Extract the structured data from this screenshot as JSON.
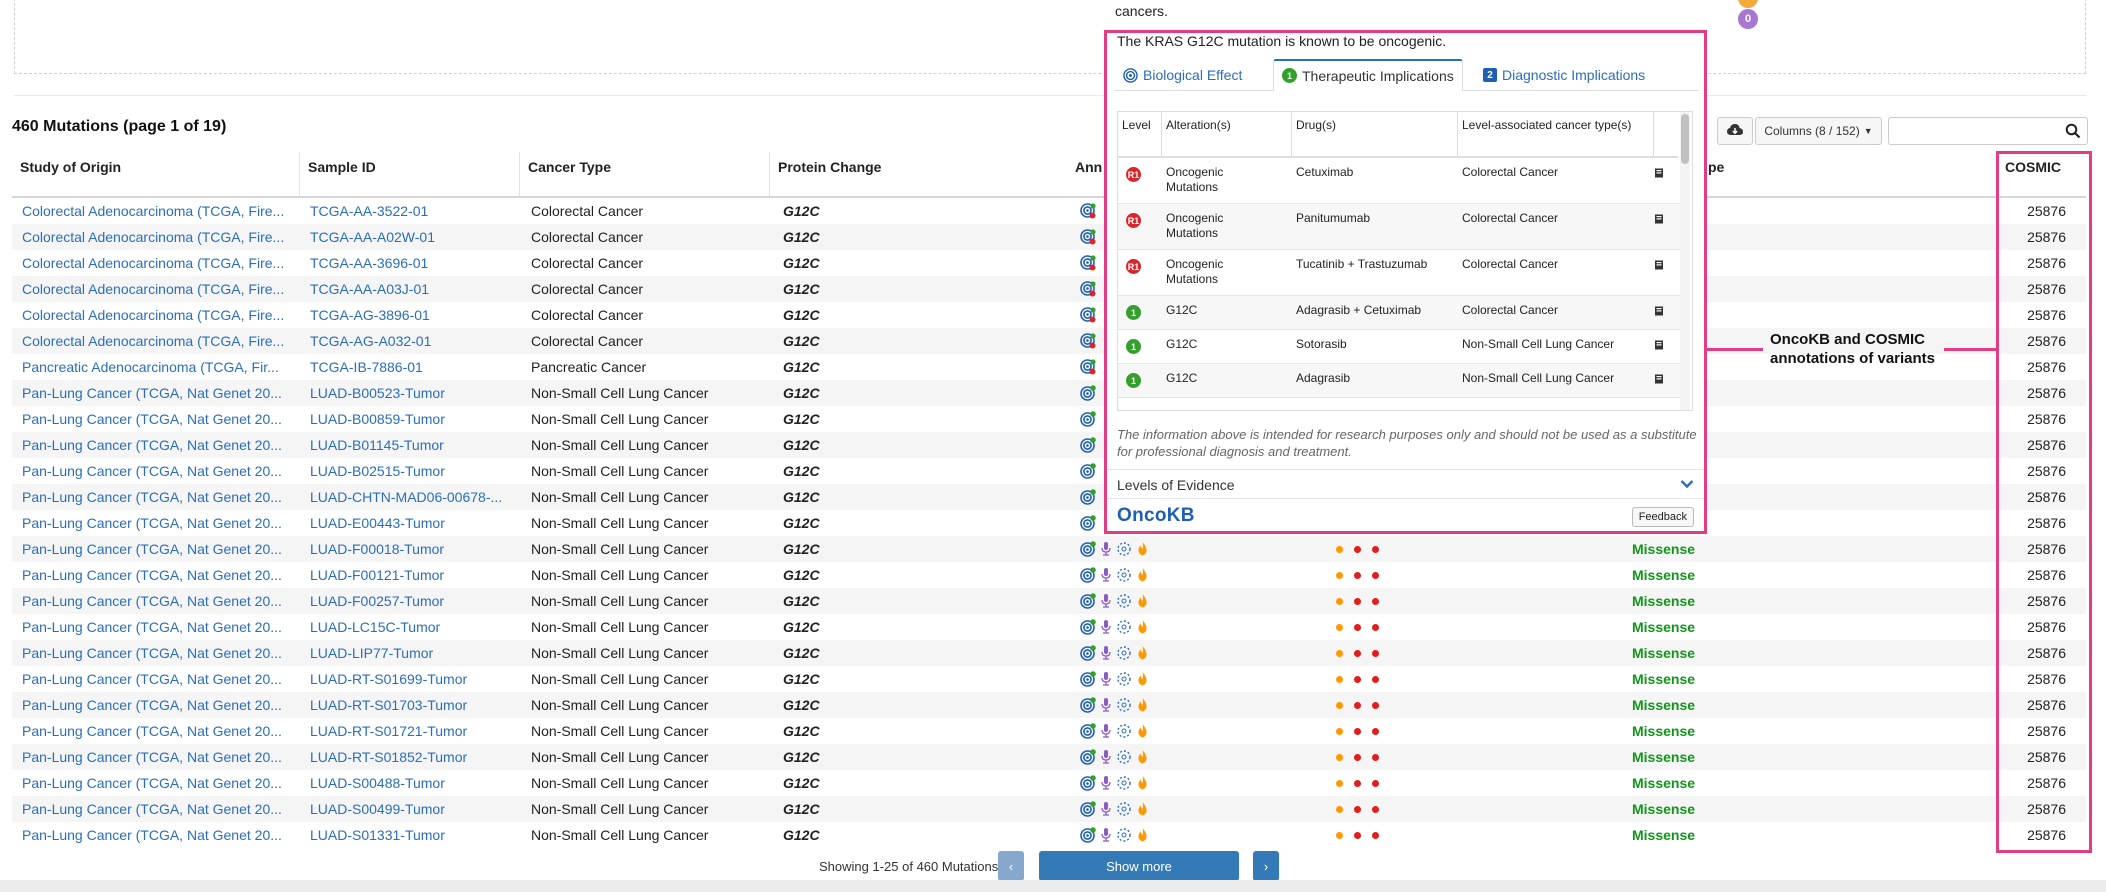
{
  "page": {
    "count_title": "460 Mutations (page 1 of 19)",
    "pager_text": "Showing 1-25 of 460 Mutations",
    "show_more": "Show more",
    "prev": "‹",
    "next": "›"
  },
  "toolbar": {
    "columns_label": "Columns (8 / 152)",
    "search_placeholder": ""
  },
  "table": {
    "headers": {
      "study": "Study of Origin",
      "sample": "Sample ID",
      "cancer": "Cancer Type",
      "protein": "Protein Change",
      "annotation": "Ann",
      "type": "pe",
      "cosmic": "COSMIC"
    },
    "rows": [
      {
        "study": "Colorectal Adenocarcinoma (TCGA, Fire...",
        "sample": "TCGA-AA-3522-01",
        "cancer": "Colorectal Cancer",
        "protein": "G12C",
        "mtype": "",
        "cosmic": "25876"
      },
      {
        "study": "Colorectal Adenocarcinoma (TCGA, Fire...",
        "sample": "TCGA-AA-A02W-01",
        "cancer": "Colorectal Cancer",
        "protein": "G12C",
        "mtype": "",
        "cosmic": "25876"
      },
      {
        "study": "Colorectal Adenocarcinoma (TCGA, Fire...",
        "sample": "TCGA-AA-3696-01",
        "cancer": "Colorectal Cancer",
        "protein": "G12C",
        "mtype": "",
        "cosmic": "25876"
      },
      {
        "study": "Colorectal Adenocarcinoma (TCGA, Fire...",
        "sample": "TCGA-AA-A03J-01",
        "cancer": "Colorectal Cancer",
        "protein": "G12C",
        "mtype": "",
        "cosmic": "25876"
      },
      {
        "study": "Colorectal Adenocarcinoma (TCGA, Fire...",
        "sample": "TCGA-AG-3896-01",
        "cancer": "Colorectal Cancer",
        "protein": "G12C",
        "mtype": "",
        "cosmic": "25876"
      },
      {
        "study": "Colorectal Adenocarcinoma (TCGA, Fire...",
        "sample": "TCGA-AG-A032-01",
        "cancer": "Colorectal Cancer",
        "protein": "G12C",
        "mtype": "",
        "cosmic": "25876"
      },
      {
        "study": "Pancreatic Adenocarcinoma (TCGA, Fir...",
        "sample": "TCGA-IB-7886-01",
        "cancer": "Pancreatic Cancer",
        "protein": "G12C",
        "mtype": "",
        "cosmic": "25876"
      },
      {
        "study": "Pan-Lung Cancer (TCGA, Nat Genet 20...",
        "sample": "LUAD-B00523-Tumor",
        "cancer": "Non-Small Cell Lung Cancer",
        "protein": "G12C",
        "mtype": "",
        "cosmic": "25876"
      },
      {
        "study": "Pan-Lung Cancer (TCGA, Nat Genet 20...",
        "sample": "LUAD-B00859-Tumor",
        "cancer": "Non-Small Cell Lung Cancer",
        "protein": "G12C",
        "mtype": "",
        "cosmic": "25876"
      },
      {
        "study": "Pan-Lung Cancer (TCGA, Nat Genet 20...",
        "sample": "LUAD-B01145-Tumor",
        "cancer": "Non-Small Cell Lung Cancer",
        "protein": "G12C",
        "mtype": "",
        "cosmic": "25876"
      },
      {
        "study": "Pan-Lung Cancer (TCGA, Nat Genet 20...",
        "sample": "LUAD-B02515-Tumor",
        "cancer": "Non-Small Cell Lung Cancer",
        "protein": "G12C",
        "mtype": "",
        "cosmic": "25876"
      },
      {
        "study": "Pan-Lung Cancer (TCGA, Nat Genet 20...",
        "sample": "LUAD-CHTN-MAD06-00678-...",
        "cancer": "Non-Small Cell Lung Cancer",
        "protein": "G12C",
        "mtype": "",
        "cosmic": "25876"
      },
      {
        "study": "Pan-Lung Cancer (TCGA, Nat Genet 20...",
        "sample": "LUAD-E00443-Tumor",
        "cancer": "Non-Small Cell Lung Cancer",
        "protein": "G12C",
        "mtype": "",
        "cosmic": "25876"
      },
      {
        "study": "Pan-Lung Cancer (TCGA, Nat Genet 20...",
        "sample": "LUAD-F00018-Tumor",
        "cancer": "Non-Small Cell Lung Cancer",
        "protein": "G12C",
        "mtype": "Missense",
        "cosmic": "25876"
      },
      {
        "study": "Pan-Lung Cancer (TCGA, Nat Genet 20...",
        "sample": "LUAD-F00121-Tumor",
        "cancer": "Non-Small Cell Lung Cancer",
        "protein": "G12C",
        "mtype": "Missense",
        "cosmic": "25876"
      },
      {
        "study": "Pan-Lung Cancer (TCGA, Nat Genet 20...",
        "sample": "LUAD-F00257-Tumor",
        "cancer": "Non-Small Cell Lung Cancer",
        "protein": "G12C",
        "mtype": "Missense",
        "cosmic": "25876"
      },
      {
        "study": "Pan-Lung Cancer (TCGA, Nat Genet 20...",
        "sample": "LUAD-LC15C-Tumor",
        "cancer": "Non-Small Cell Lung Cancer",
        "protein": "G12C",
        "mtype": "Missense",
        "cosmic": "25876"
      },
      {
        "study": "Pan-Lung Cancer (TCGA, Nat Genet 20...",
        "sample": "LUAD-LIP77-Tumor",
        "cancer": "Non-Small Cell Lung Cancer",
        "protein": "G12C",
        "mtype": "Missense",
        "cosmic": "25876"
      },
      {
        "study": "Pan-Lung Cancer (TCGA, Nat Genet 20...",
        "sample": "LUAD-RT-S01699-Tumor",
        "cancer": "Non-Small Cell Lung Cancer",
        "protein": "G12C",
        "mtype": "Missense",
        "cosmic": "25876"
      },
      {
        "study": "Pan-Lung Cancer (TCGA, Nat Genet 20...",
        "sample": "LUAD-RT-S01703-Tumor",
        "cancer": "Non-Small Cell Lung Cancer",
        "protein": "G12C",
        "mtype": "Missense",
        "cosmic": "25876"
      },
      {
        "study": "Pan-Lung Cancer (TCGA, Nat Genet 20...",
        "sample": "LUAD-RT-S01721-Tumor",
        "cancer": "Non-Small Cell Lung Cancer",
        "protein": "G12C",
        "mtype": "Missense",
        "cosmic": "25876"
      },
      {
        "study": "Pan-Lung Cancer (TCGA, Nat Genet 20...",
        "sample": "LUAD-RT-S01852-Tumor",
        "cancer": "Non-Small Cell Lung Cancer",
        "protein": "G12C",
        "mtype": "Missense",
        "cosmic": "25876"
      },
      {
        "study": "Pan-Lung Cancer (TCGA, Nat Genet 20...",
        "sample": "LUAD-S00488-Tumor",
        "cancer": "Non-Small Cell Lung Cancer",
        "protein": "G12C",
        "mtype": "Missense",
        "cosmic": "25876"
      },
      {
        "study": "Pan-Lung Cancer (TCGA, Nat Genet 20...",
        "sample": "LUAD-S00499-Tumor",
        "cancer": "Non-Small Cell Lung Cancer",
        "protein": "G12C",
        "mtype": "Missense",
        "cosmic": "25876"
      },
      {
        "study": "Pan-Lung Cancer (TCGA, Nat Genet 20...",
        "sample": "LUAD-S01331-Tumor",
        "cancer": "Non-Small Cell Lung Cancer",
        "protein": "G12C",
        "mtype": "Missense",
        "cosmic": "25876"
      }
    ]
  },
  "popover": {
    "top_text": "cancers.",
    "summary": "The KRAS G12C mutation is known to be oncogenic.",
    "tabs": [
      {
        "label": "Biological Effect",
        "badge": ""
      },
      {
        "label": "Therapeutic Implications",
        "badge": "1"
      },
      {
        "label": "Diagnostic Implications",
        "badge": "2"
      }
    ],
    "columns": {
      "level": "Level",
      "alteration": "Alteration(s)",
      "drugs": "Drug(s)",
      "cancer_type": "Level-associated cancer type(s)"
    },
    "rows": [
      {
        "level": "R1",
        "alteration": "Oncogenic Mutations",
        "drug": "Cetuximab",
        "cancer": "Colorectal Cancer"
      },
      {
        "level": "R1",
        "alteration": "Oncogenic Mutations",
        "drug": "Panitumumab",
        "cancer": "Colorectal Cancer"
      },
      {
        "level": "R1",
        "alteration": "Oncogenic Mutations",
        "drug": "Tucatinib + Trastuzumab",
        "cancer": "Colorectal Cancer"
      },
      {
        "level": "1",
        "alteration": "G12C",
        "drug": "Adagrasib + Cetuximab",
        "cancer": "Colorectal Cancer"
      },
      {
        "level": "1",
        "alteration": "G12C",
        "drug": "Sotorasib",
        "cancer": "Non-Small Cell Lung Cancer"
      },
      {
        "level": "1",
        "alteration": "G12C",
        "drug": "Adagrasib",
        "cancer": "Non-Small Cell Lung Cancer"
      }
    ],
    "disclaimer": "The information above is intended for research purposes only and should not be used as a substitute for professional diagnosis and treatment.",
    "levels_label": "Levels of Evidence",
    "logo": "OncoKB",
    "feedback": "Feedback"
  },
  "badges": {
    "purple_count": "0"
  },
  "callout": {
    "line1": "OncoKB and COSMIC",
    "line2": "annotations of variants"
  },
  "colors": {
    "link": "#2a6ebb",
    "missense": "#109618",
    "highlight": "#e23c82",
    "level_r1": "#d9262c",
    "level_1": "#33a02c",
    "hotspot": "#ff9900",
    "dot_red": "#e11d1d"
  }
}
